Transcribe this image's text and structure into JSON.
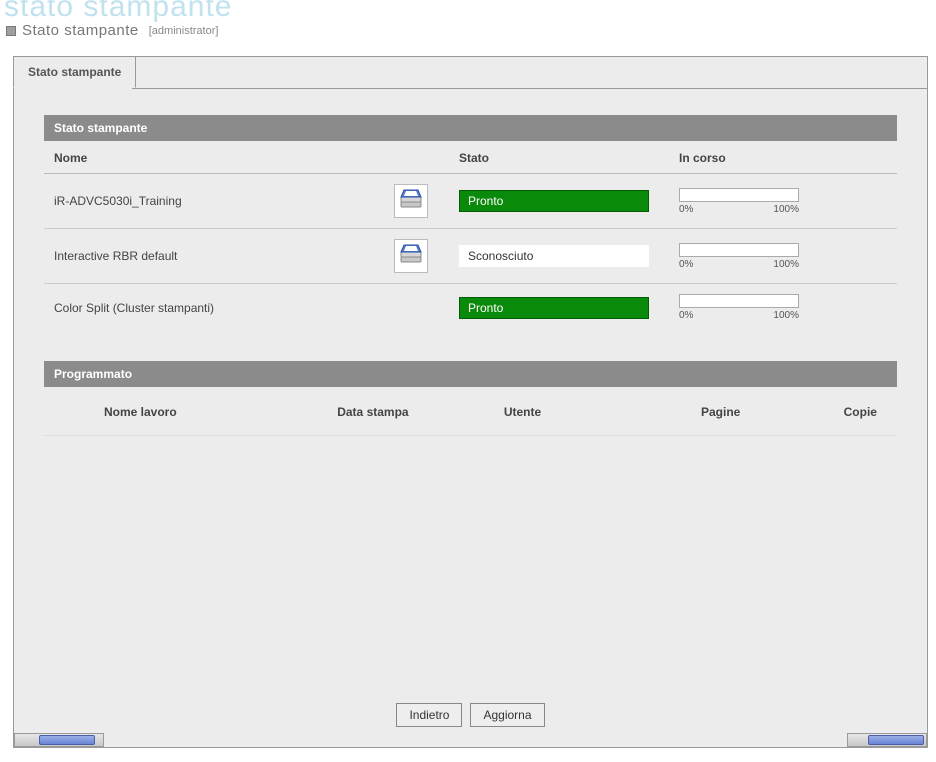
{
  "bg_title": "stato stampante",
  "header": {
    "title": "Stato stampante",
    "user": "[administrator]"
  },
  "tabs": [
    {
      "label": "Stato stampante"
    }
  ],
  "printer_status_section": {
    "title": "Stato stampante",
    "columns": {
      "name": "Nome",
      "status": "Stato",
      "progress": "In corso"
    },
    "progress_labels": {
      "min": "0%",
      "max": "100%"
    },
    "rows": [
      {
        "name": "iR-ADVC5030i_Training",
        "has_icon": true,
        "status": "Pronto",
        "status_style": "green"
      },
      {
        "name": "Interactive RBR default",
        "has_icon": true,
        "status": "Sconosciuto",
        "status_style": "white"
      },
      {
        "name": "Color Split (Cluster stampanti)",
        "has_icon": false,
        "status": "Pronto",
        "status_style": "green"
      }
    ]
  },
  "scheduled_section": {
    "title": "Programmato",
    "columns": {
      "job_name": "Nome lavoro",
      "date": "Data stampa",
      "user": "Utente",
      "pages": "Pagine",
      "copies": "Copie"
    }
  },
  "buttons": {
    "back": "Indietro",
    "refresh": "Aggiorna"
  }
}
